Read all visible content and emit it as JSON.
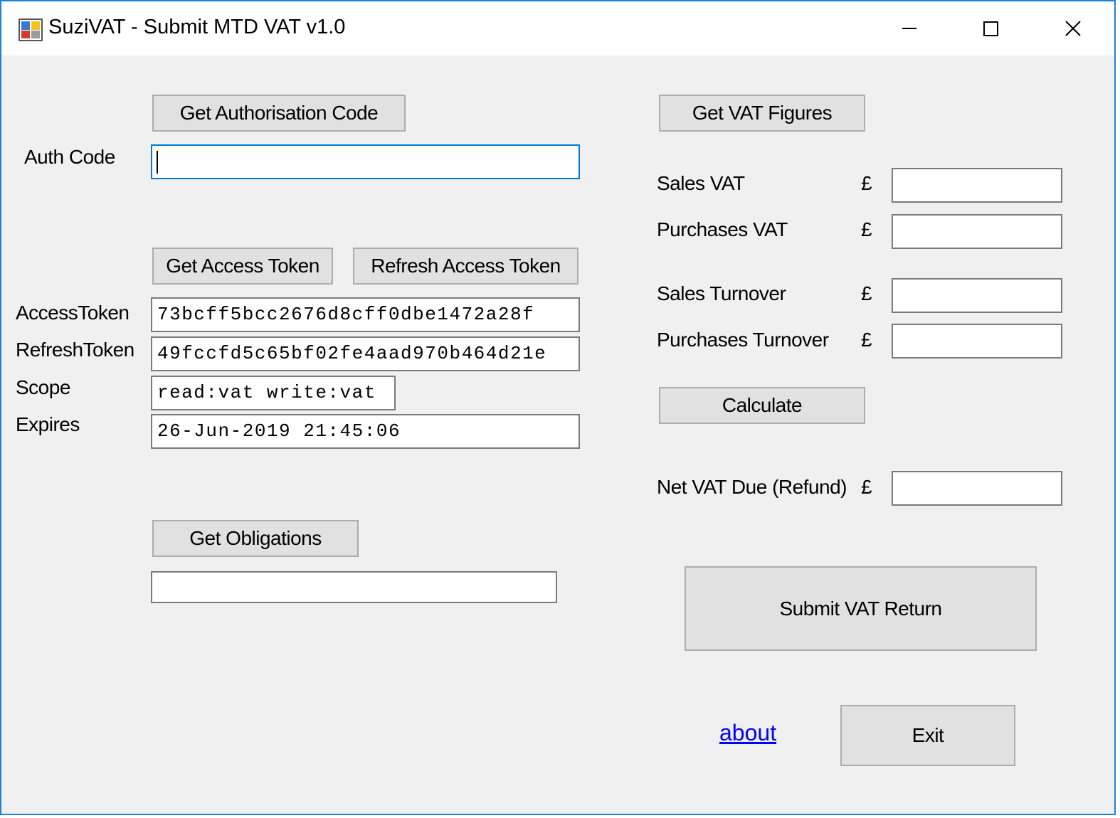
{
  "window": {
    "title": "SuziVAT - Submit MTD VAT v1.0",
    "icon": "app-icon",
    "controls": {
      "minimize": "minimize-icon",
      "maximize": "maximize-icon",
      "close": "close-icon"
    }
  },
  "auth": {
    "get_code_label": "Get Authorisation Code",
    "code_label": "Auth Code",
    "code_value": ""
  },
  "token": {
    "get_label": "Get Access Token",
    "refresh_label": "Refresh Access Token",
    "access_label": "AccessToken",
    "access_value": "73bcff5bcc2676d8cff0dbe1472a28f",
    "refresh_token_label": "RefreshToken",
    "refresh_value": "49fccfd5c65bf02fe4aad970b464d21e",
    "scope_label": "Scope",
    "scope_value": "read:vat write:vat",
    "expires_label": "Expires",
    "expires_value": "26-Jun-2019 21:45:06"
  },
  "obligations": {
    "button_label": "Get Obligations",
    "value": ""
  },
  "vat": {
    "get_figures_label": "Get VAT Figures",
    "currency_symbol": "£",
    "sales_vat_label": "Sales VAT",
    "sales_vat_value": "",
    "purchases_vat_label": "Purchases VAT",
    "purchases_vat_value": "",
    "sales_turnover_label": "Sales Turnover",
    "sales_turnover_value": "",
    "purchases_turnover_label": "Purchases Turnover",
    "purchases_turnover_value": "",
    "calculate_label": "Calculate",
    "net_due_label": "Net VAT Due (Refund)",
    "net_due_value": "",
    "submit_label": "Submit VAT Return"
  },
  "footer": {
    "about_label": "about",
    "exit_label": "Exit"
  },
  "colors": {
    "window_border": "#1883d7",
    "form_background": "#f0f0f0",
    "button_face": "#e1e1e1",
    "focus_border": "#0078d7",
    "link": "#0000ff"
  }
}
